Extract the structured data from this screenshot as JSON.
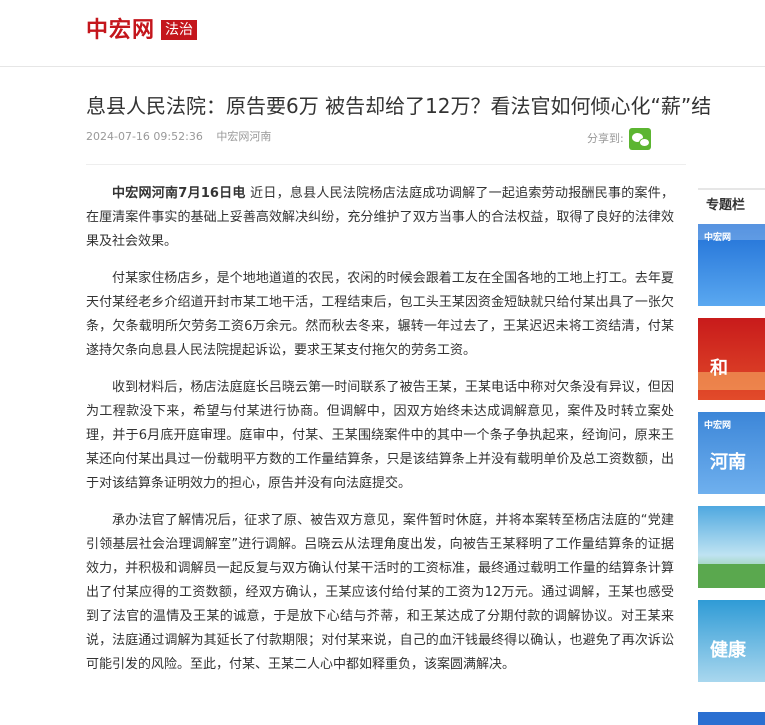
{
  "header": {
    "logo_text": "中宏网",
    "logo_tag": "法治"
  },
  "article": {
    "title": "息县人民法院：原告要6万 被告却给了12万？看法官如何倾心化“薪”结",
    "date": "2024-07-16 09:52:36",
    "source": "中宏网河南",
    "share_label": "分享到:",
    "lead_source": "中宏网河南7月16日电",
    "paragraphs": [
      "近日，息县人民法院杨店法庭成功调解了一起追索劳动报酬民事的案件，在厘清案件事实的基础上妥善高效解决纠纷，充分维护了双方当事人的合法权益，取得了良好的法律效果及社会效果。",
      "付某家住杨店乡，是个地地道道的农民，农闲的时候会跟着工友在全国各地的工地上打工。去年夏天付某经老乡介绍道开封市某工地干活，工程结束后，包工头王某因资金短缺就只给付某出具了一张欠条，欠条载明所欠劳务工资6万余元。然而秋去冬来，辗转一年过去了，王某迟迟未将工资结清，付某遂持欠条向息县人民法院提起诉讼，要求王某支付拖欠的劳务工资。",
      "收到材料后，杨店法庭庭长吕晓云第一时间联系了被告王某，王某电话中称对欠条没有异议，但因为工程款没下来，希望与付某进行协商。但调解中，因双方始终未达成调解意见，案件及时转立案处理，并于6月底开庭审理。庭审中，付某、王某围绕案件中的其中一个条子争执起来，经询问，原来王某还向付某出具过一份载明平方数的工作量结算条，只是该结算条上并没有载明单价及总工资数额，出于对该结算条证明效力的担心，原告并没有向法庭提交。",
      "承办法官了解情况后，征求了原、被告双方意见，案件暂时休庭，并将本案转至杨店法庭的“党建引领基层社会治理调解室”进行调解。吕晓云从法理角度出发，向被告王某释明了工作量结算条的证据效力，并积极和调解员一起反复与双方确认付某干活时的工资标准，最终通过载明工作量的结算条计算出了付某应得的工资数额，经双方确认，王某应该付给付某的工资为12万元。通过调解，王某也感受到了法官的温情及王某的诚意，于是放下心结与芥蒂，和王某达成了分期付款的调解协议。对王某来说，法庭通过调解为其延长了付款期限；对付某来说，自己的血汗钱最终得以确认，也避免了再次诉讼可能引发的风险。至此，付某、王某二人心中都如释重负，该案圆满解决。"
    ]
  },
  "sidebar": {
    "title": "专题栏",
    "thumbs": [
      {
        "badge": "中宏网",
        "text": ""
      },
      {
        "badge": "",
        "text": "和"
      },
      {
        "badge": "中宏网",
        "text": "河南"
      },
      {
        "badge": "",
        "text": ""
      },
      {
        "badge": "",
        "text": "健康"
      }
    ]
  },
  "colors": {
    "brand_red": "#c4161c",
    "wechat_green": "#5cb531"
  },
  "icons": [
    "wechat-icon"
  ]
}
